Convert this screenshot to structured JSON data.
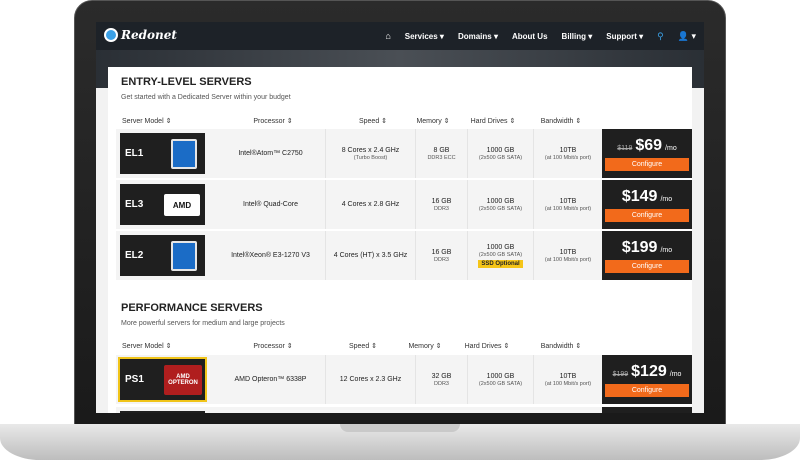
{
  "nav": {
    "logo": "Redonet",
    "items": [
      "Services",
      "Domains",
      "About Us",
      "Billing",
      "Support"
    ]
  },
  "colors": {
    "accent": "#f26a1b",
    "nav_bg": "#1d2228",
    "search": "#3aa0e6",
    "ssd_badge": "#f5c518"
  },
  "entry": {
    "title": "ENTRY-LEVEL SERVERS",
    "subtitle": "Get started with a Dedicated Server within your budget",
    "headers": [
      "Server Model",
      "Processor",
      "Speed",
      "Memory",
      "Hard Drives",
      "Bandwidth"
    ],
    "rows": [
      {
        "model": "EL1",
        "chip": "intel-chip-icon",
        "processor": "Intel®Atom™ C2750",
        "speed": "8 Cores x 2.4 GHz",
        "speed_sub": "(Turbo Boost)",
        "memory": "8 GB",
        "memory_sub": "DDR3 ECC",
        "drives": "1000 GB",
        "drives_sub": "(2x500 GB SATA)",
        "bandwidth": "10TB",
        "bandwidth_sub": "(at 100 Mbit/s port)",
        "old_price": "$119",
        "price": "$69",
        "per": "/mo",
        "configure": "Configure"
      },
      {
        "model": "EL3",
        "chip": "amd-logo-icon",
        "chip_text": "AMD",
        "processor": "Intel® Quad-Core",
        "speed": "4 Cores x 2.8 GHz",
        "memory": "16 GB",
        "memory_sub": "DDR3",
        "drives": "1000 GB",
        "drives_sub": "(2x500 GB SATA)",
        "bandwidth": "10TB",
        "bandwidth_sub": "(at 100 Mbit/s port)",
        "price": "$149",
        "per": "/mo",
        "configure": "Configure"
      },
      {
        "model": "EL2",
        "chip": "intel-chip-icon",
        "processor": "Intel®Xeon® E3-1270 V3",
        "speed": "4 Cores (HT) x 3.5 GHz",
        "memory": "16 GB",
        "memory_sub": "DDR3",
        "drives": "1000 GB",
        "drives_sub": "(2x500 GB SATA)",
        "ssd": "SSD Optional",
        "bandwidth": "10TB",
        "bandwidth_sub": "(at 100 Mbit/s port)",
        "price": "$199",
        "per": "/mo",
        "configure": "Configure"
      }
    ]
  },
  "performance": {
    "title": "PERFORMANCE SERVERS",
    "subtitle": "More powerful servers for medium and large projects",
    "headers": [
      "Server Model",
      "Processor",
      "Speed",
      "Memory",
      "Hard Drives",
      "Bandwidth"
    ],
    "rows": [
      {
        "model": "PS1",
        "chip": "amd-opteron-icon",
        "chip_text": "AMD",
        "chip_sub": "OPTERON",
        "processor": "AMD Opteron™ 6338P",
        "speed": "12 Cores x 2.3 GHz",
        "memory": "32 GB",
        "memory_sub": "DDR3",
        "drives": "1000 GB",
        "drives_sub": "(2x500 GB SATA)",
        "bandwidth": "10TB",
        "bandwidth_sub": "(at 100 Mbit/s port)",
        "old_price": "$199",
        "price": "$129",
        "per": "/mo",
        "configure": "Configure"
      }
    ]
  }
}
